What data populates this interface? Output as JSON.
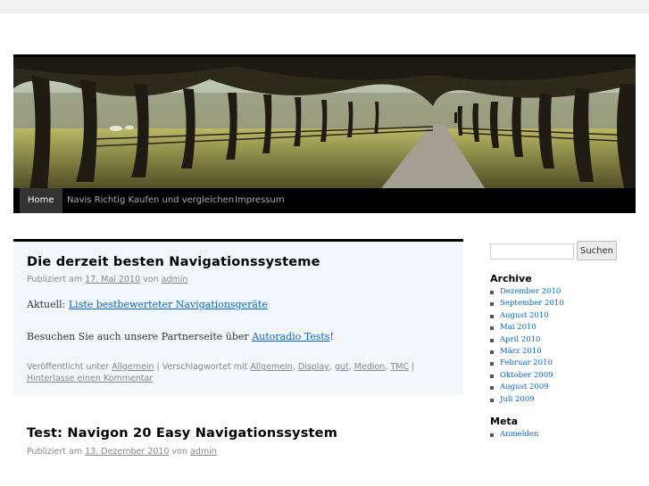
{
  "nav": {
    "items": [
      {
        "label": "Home",
        "current": true
      },
      {
        "label": "Navis Richtig Kaufen und vergleichen",
        "current": false
      },
      {
        "label": "Impressum",
        "current": false
      }
    ]
  },
  "posts": [
    {
      "title": "Die derzeit besten Navigationssysteme",
      "meta_prefix": "Publiziert am",
      "date": "17. Mai 2010",
      "meta_by": "von",
      "author": "admin",
      "line1_prefix": "Aktuell:",
      "line1_link": "Liste bestbewerteter Navigationsgeräte",
      "line2_prefix": "Besuchen Sie auch unsere Partnerseite über",
      "line2_link": "Autoradio Tests",
      "line2_suffix": "!",
      "utility": {
        "posted_in": "Veröffentlicht unter",
        "category": "Allgemein",
        "sep1": " | ",
        "tagged": "Verschlagwortet mit",
        "tags": [
          "Allgemein",
          "Display",
          "gut",
          "Medion",
          "TMC"
        ],
        "sep2": " | ",
        "comment_link": "Hinterlasse einen Kommentar"
      }
    },
    {
      "title": "Test: Navigon 20 Easy Navigationssystem",
      "meta_prefix": "Publiziert am",
      "date": "13. Dezember 2010",
      "meta_by": "von",
      "author": "admin"
    }
  ],
  "sidebar": {
    "search": {
      "placeholder": "",
      "value": "",
      "button": "Suchen"
    },
    "archive_title": "Archive",
    "archive_items": [
      "Dezember 2010",
      "September 2010",
      "August 2010",
      "Mai 2010",
      "April 2010",
      "März 2010",
      "Februar 2010",
      "Oktober 2009",
      "August 2009",
      "Juli 2009"
    ],
    "meta_title": "Meta",
    "meta_items": [
      "Anmelden"
    ]
  },
  "colors": {
    "link": "#0066cc",
    "sticky_bg": "#f2f7fc",
    "nav_bg": "#000000"
  }
}
